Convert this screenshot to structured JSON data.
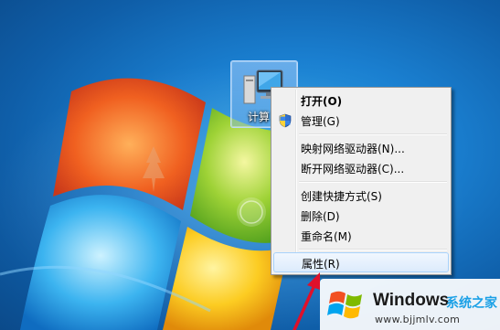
{
  "desktop": {
    "icon_label": "计算"
  },
  "context_menu": {
    "items": [
      {
        "label": "打开(O)",
        "bold": true
      },
      {
        "label": "管理(G)",
        "bold": false
      },
      {
        "label": "映射网络驱动器(N)...",
        "bold": false
      },
      {
        "label": "断开网络驱动器(C)...",
        "bold": false
      },
      {
        "label": "创建快捷方式(S)",
        "bold": false
      },
      {
        "label": "删除(D)",
        "bold": false
      },
      {
        "label": "重命名(M)",
        "bold": false
      },
      {
        "label": "属性(R)",
        "bold": false,
        "highlighted": true
      }
    ]
  },
  "watermark": {
    "brand": "Windows",
    "brand_cn": "系统之家",
    "url": "www.bjjmlv.com"
  },
  "colors": {
    "arrow": "#e0102a",
    "menu_highlight_border": "#a8d2fb",
    "watermark_accent": "#1aa0e6"
  }
}
